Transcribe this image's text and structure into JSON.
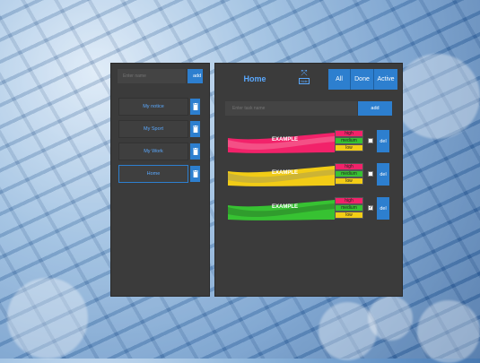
{
  "left_panel": {
    "name_input_placeholder": "Enter name",
    "add_label": "add",
    "lists": [
      {
        "label": "My notice",
        "active": false
      },
      {
        "label": "My Sport",
        "active": false
      },
      {
        "label": "My Work",
        "active": false
      },
      {
        "label": "Home",
        "active": true
      }
    ]
  },
  "right_panel": {
    "title": "Home",
    "hide_label": "hide",
    "filters": [
      "All",
      "Done",
      "Active"
    ],
    "task_input_placeholder": "Enter task name",
    "add_label": "add",
    "tasks": [
      {
        "name": "EXAMPLE",
        "color": "#f2226a",
        "priorities": [
          "high",
          "medium",
          "low"
        ],
        "checked": false,
        "del_label": "del"
      },
      {
        "name": "EXAMPLE",
        "color": "#f2cc16",
        "priorities": [
          "high",
          "medium",
          "low"
        ],
        "checked": false,
        "del_label": "del"
      },
      {
        "name": "EXAMPLE",
        "color": "#37c232",
        "priorities": [
          "high",
          "medium",
          "low"
        ],
        "checked": true,
        "del_label": "del"
      }
    ]
  },
  "colors": {
    "accent": "#2d7fcf",
    "panel": "#3b3b3b",
    "link": "#5aa9ff"
  }
}
